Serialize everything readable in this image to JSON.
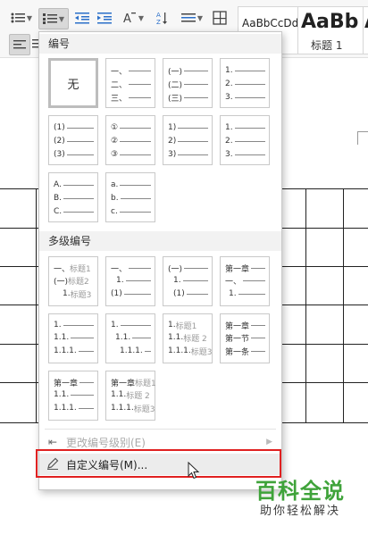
{
  "ribbon": {
    "styles": [
      {
        "sample": "AaBbCcDd",
        "name": ""
      },
      {
        "sample": "AaBb",
        "name": "标题 1"
      },
      {
        "sample": "A",
        "name": ""
      }
    ]
  },
  "menu": {
    "section_numbering": "编号",
    "none_label": "无",
    "numbering_tiles": [
      [
        "一、",
        "二、",
        "三、"
      ],
      [
        "(一)",
        "(二)",
        "(三)"
      ],
      [
        "1.",
        "2.",
        "3."
      ],
      [
        "(1)",
        "(2)",
        "(3)"
      ],
      [
        "①",
        "②",
        "③"
      ],
      [
        "1)",
        "2)",
        "3)"
      ],
      [
        "1.",
        "2.",
        "3."
      ],
      [
        "A.",
        "B.",
        "C."
      ],
      [
        "a.",
        "b.",
        "c."
      ]
    ],
    "section_multilevel": "多级编号",
    "multilevel_tiles": [
      [
        {
          "n": "一、",
          "t": "标题1"
        },
        {
          "n": "(一)",
          "t": "标题2"
        },
        {
          "n": "1.",
          "t": "标题3"
        }
      ],
      [
        {
          "n": "一、",
          "t": ""
        },
        {
          "n": "1.",
          "t": ""
        },
        {
          "n": "(1)",
          "t": ""
        }
      ],
      [
        {
          "n": "(一)",
          "t": ""
        },
        {
          "n": "1.",
          "t": ""
        },
        {
          "n": "(1)",
          "t": ""
        }
      ],
      [
        {
          "n": "第一章",
          "t": ""
        },
        {
          "n": "一、",
          "t": ""
        },
        {
          "n": "1.",
          "t": ""
        }
      ],
      [
        {
          "n": "1.",
          "t": ""
        },
        {
          "n": "1.1.",
          "t": ""
        },
        {
          "n": "1.1.1.",
          "t": ""
        }
      ],
      [
        {
          "n": "1.",
          "t": ""
        },
        {
          "n": "1.1.",
          "t": ""
        },
        {
          "n": "1.1.1.",
          "t": ""
        }
      ],
      [
        {
          "n": "1.",
          "t": "标题1"
        },
        {
          "n": "1.1.",
          "t": "标题 2"
        },
        {
          "n": "1.1.1.",
          "t": "标题3"
        }
      ],
      [
        {
          "n": "第一章",
          "t": ""
        },
        {
          "n": "第一节",
          "t": ""
        },
        {
          "n": "第一条",
          "t": ""
        }
      ],
      [
        {
          "n": "第一章",
          "t": ""
        },
        {
          "n": "1.1.",
          "t": ""
        },
        {
          "n": "1.1.1.",
          "t": ""
        }
      ],
      [
        {
          "n": "第一章",
          "t": "标题1"
        },
        {
          "n": "1.1.",
          "t": "标题 2"
        },
        {
          "n": "1.1.1.",
          "t": "标题3"
        }
      ]
    ],
    "change_level_label": "更改编号级别(E)",
    "custom_label": "自定义编号(M)..."
  },
  "watermark": {
    "title": "百科全说",
    "subtitle": "助你轻松解决"
  },
  "colors": {
    "highlight_border": "#e02020",
    "watermark_green": "#3fa33a"
  }
}
